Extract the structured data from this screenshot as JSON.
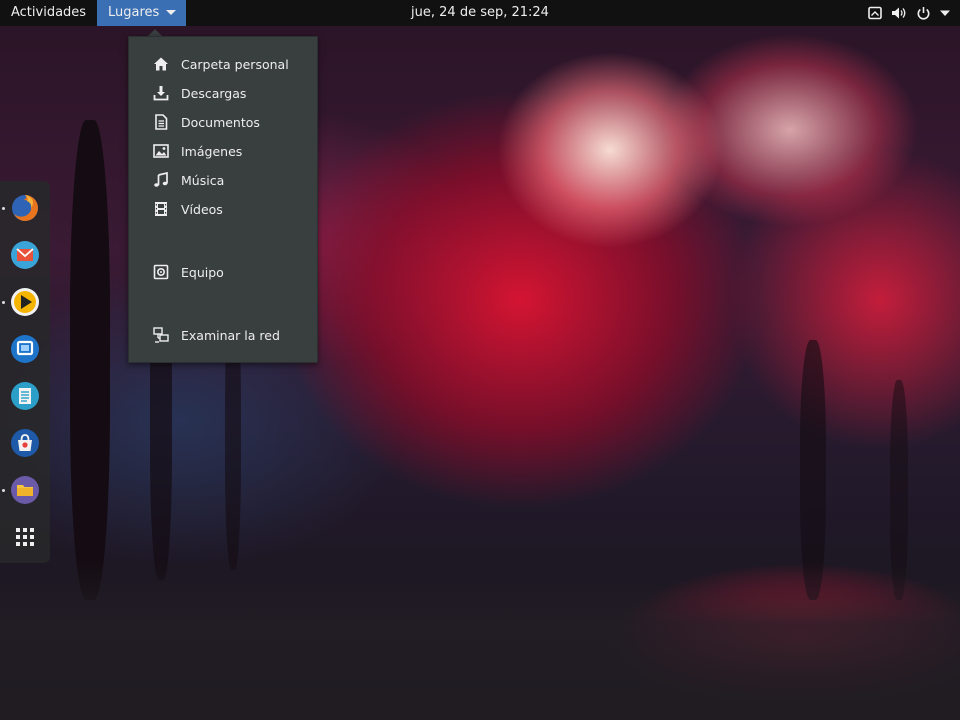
{
  "topbar": {
    "activities": "Actividades",
    "places_menu": "Lugares",
    "clock": "jue, 24 de sep, 21:24",
    "tray_icons": [
      "screen-icon",
      "volume-icon",
      "power-icon",
      "chevron-down-icon"
    ]
  },
  "places_menu": {
    "items": [
      {
        "label": "Carpeta personal",
        "icon": "home-icon"
      },
      {
        "label": "Descargas",
        "icon": "download-icon"
      },
      {
        "label": "Documentos",
        "icon": "document-icon"
      },
      {
        "label": "Imágenes",
        "icon": "image-icon"
      },
      {
        "label": "Música",
        "icon": "music-icon"
      },
      {
        "label": "Vídeos",
        "icon": "video-icon"
      },
      {
        "label": "Equipo",
        "icon": "computer-icon"
      },
      {
        "label": "Examinar la red",
        "icon": "network-icon"
      }
    ]
  },
  "dash": {
    "apps": [
      {
        "name": "firefox-icon",
        "running": true
      },
      {
        "name": "mail-icon",
        "running": false
      },
      {
        "name": "media-player-icon",
        "running": true
      },
      {
        "name": "virtual-machine-icon",
        "running": false
      },
      {
        "name": "text-editor-icon",
        "running": false
      },
      {
        "name": "software-center-icon",
        "running": false
      },
      {
        "name": "files-icon",
        "running": true
      },
      {
        "name": "show-applications-icon",
        "running": false
      }
    ]
  },
  "colors": {
    "topbar_bg": "#111111",
    "accent": "#3b6fb3",
    "menu_bg": "#393f3f",
    "text": "#eeeeee"
  }
}
